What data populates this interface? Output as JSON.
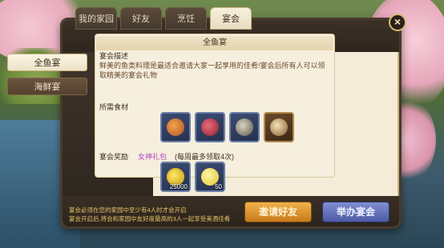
{
  "tabs": [
    {
      "label": "我的家园",
      "active": false
    },
    {
      "label": "好友",
      "active": false
    },
    {
      "label": "烹饪",
      "active": false
    },
    {
      "label": "宴会",
      "active": true
    }
  ],
  "close_label": "×",
  "sidebar": {
    "items": [
      {
        "label": "全鱼宴",
        "active": true
      },
      {
        "label": "海鲜宴",
        "active": false
      }
    ]
  },
  "content": {
    "title": "全鱼宴",
    "desc_label": "宴会描述",
    "desc_text": "鲜美的鱼类料理是最适合邀请大家一起享用的佳肴!宴会后所有人可以领取精美的宴会礼物",
    "ingredients_label": "所需食材",
    "ingredients": [
      {
        "icon": "fish-dish-icon",
        "frame": "blue"
      },
      {
        "icon": "potion-dish-icon",
        "frame": "blue"
      },
      {
        "icon": "fish-bowl-icon",
        "frame": "blue"
      },
      {
        "icon": "stew-bowl-icon",
        "frame": "gold"
      }
    ],
    "reward_label": "宴会奖励",
    "reward_name": "女神礼包",
    "reward_note": "(每周最多领取4次)",
    "rewards": [
      {
        "icon": "gold-coin-icon",
        "qty": "25000"
      },
      {
        "icon": "c-coin-icon",
        "qty": "50"
      }
    ]
  },
  "footer": {
    "note1": "宴会必须在您的家园中至少有4人时才会开启",
    "note2": "宴会开启后,将会和家园中友好度最高的3人一起享受美酒佳肴",
    "invite_label": "邀请好友",
    "host_label": "举办宴会"
  }
}
